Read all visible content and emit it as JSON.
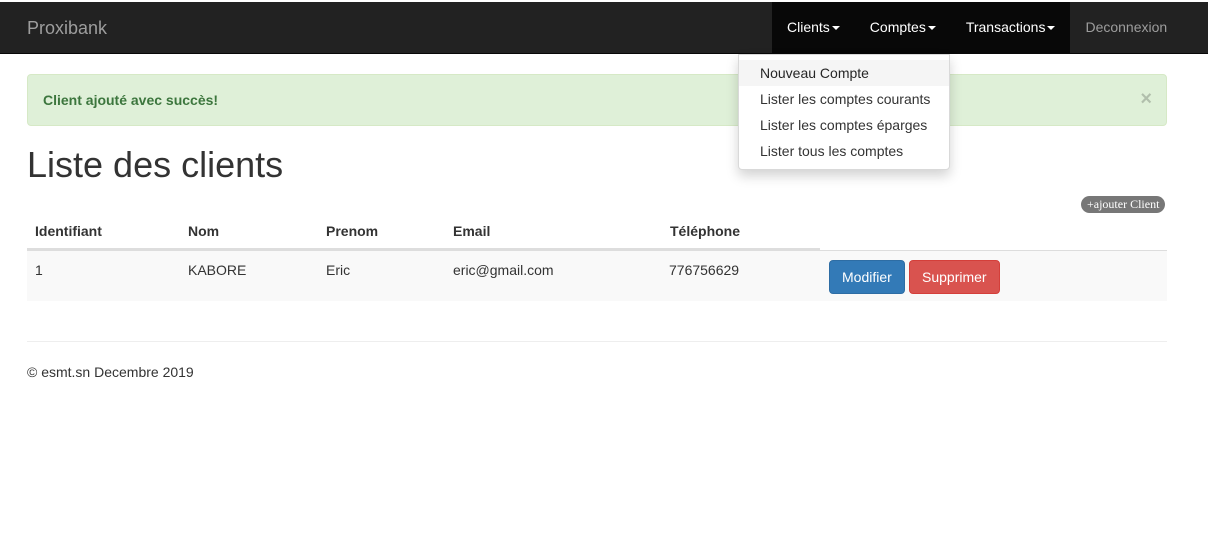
{
  "navbar": {
    "brand": "Proxibank",
    "items": [
      {
        "label": "Clients"
      },
      {
        "label": "Comptes"
      },
      {
        "label": "Transactions"
      }
    ],
    "logout": "Deconnexion"
  },
  "dropdown": {
    "items": [
      {
        "label": "Nouveau Compte"
      },
      {
        "label": "Lister les comptes courants"
      },
      {
        "label": "Lister les comptes éparges"
      },
      {
        "label": "Lister tous les comptes"
      }
    ]
  },
  "alert": {
    "message": "Client ajouté avec succès!",
    "close": "×"
  },
  "page": {
    "title": "Liste des clients",
    "add_button": "+ajouter Client"
  },
  "table": {
    "headers": [
      "Identifiant",
      "Nom",
      "Prenom",
      "Email",
      "Téléphone"
    ],
    "rows": [
      {
        "id": "1",
        "nom": "KABORE",
        "prenom": "Eric",
        "email": "eric@gmail.com",
        "telephone": "776756629",
        "modify_label": "Modifier",
        "delete_label": "Supprimer"
      }
    ]
  },
  "footer": {
    "text": "© esmt.sn Decembre 2019"
  },
  "colors": {
    "navbar_bg": "#222222",
    "alert_bg": "#dff0d8",
    "primary": "#337ab7",
    "danger": "#d9534f"
  }
}
